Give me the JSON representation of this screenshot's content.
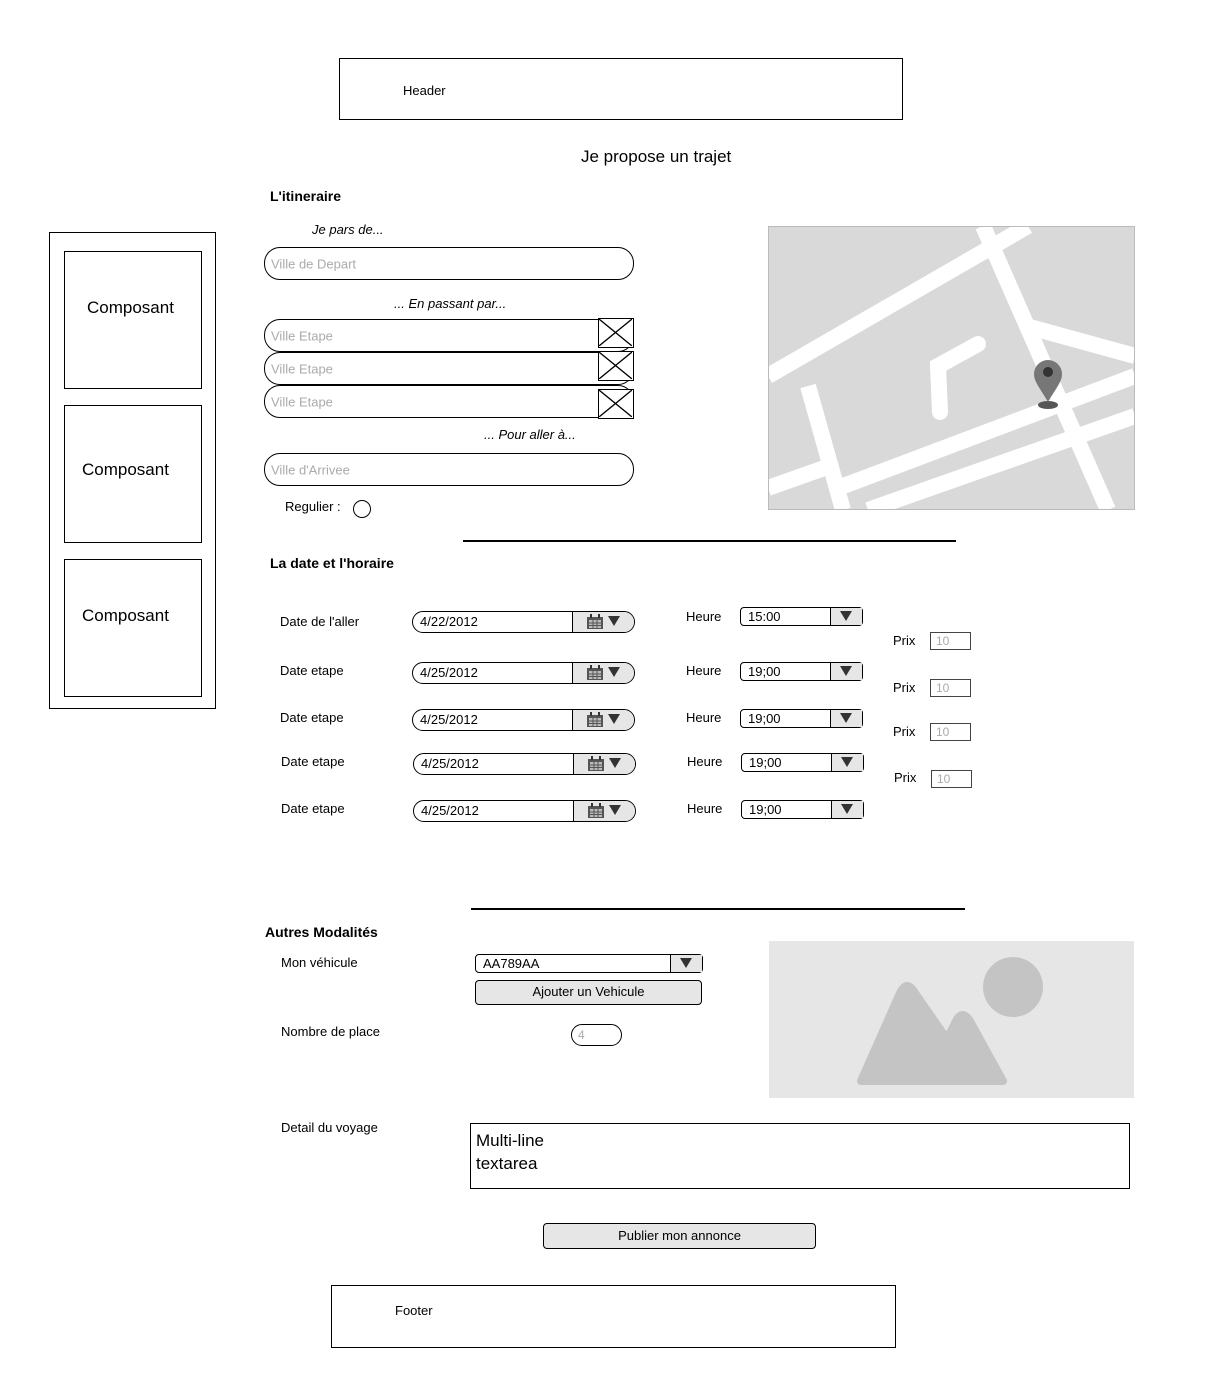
{
  "header": {
    "label": "Header"
  },
  "page_title": "Je propose un trajet",
  "sidebar": {
    "items": [
      {
        "label": "Composant"
      },
      {
        "label": "Composant"
      },
      {
        "label": "Composant"
      }
    ]
  },
  "itinerary": {
    "heading": "L'itineraire",
    "from_label": "Je pars de...",
    "from_placeholder": "Ville de Depart",
    "via_label": "... En passant par...",
    "steps": [
      {
        "placeholder": "Ville Etape"
      },
      {
        "placeholder": "Ville Etape"
      },
      {
        "placeholder": "Ville Etape"
      }
    ],
    "to_label": "... Pour aller à...",
    "to_placeholder": "Ville d'Arrivee",
    "regular_label": "Regulier :"
  },
  "schedule": {
    "heading": "La date et l'horaire",
    "rows": [
      {
        "date_label": "Date de l'aller",
        "date": "4/22/2012",
        "heure_label": "Heure",
        "time": "15:00"
      },
      {
        "date_label": "Date etape",
        "date": "4/25/2012",
        "heure_label": "Heure",
        "time": "19;00"
      },
      {
        "date_label": "Date  etape",
        "date": "4/25/2012",
        "heure_label": "Heure",
        "time": "19;00"
      },
      {
        "date_label": "Date  etape",
        "date": "4/25/2012",
        "heure_label": "Heure",
        "time": "19;00"
      },
      {
        "date_label": "Date  etape",
        "date": "4/25/2012",
        "heure_label": "Heure",
        "time": "19;00"
      }
    ],
    "prices": [
      {
        "label": "Prix",
        "placeholder": "10"
      },
      {
        "label": "Prix",
        "placeholder": "10"
      },
      {
        "label": "Prix",
        "placeholder": "10"
      },
      {
        "label": "Prix",
        "placeholder": "10"
      }
    ]
  },
  "other": {
    "heading": "Autres Modalités",
    "vehicle_label": "Mon véhicule",
    "vehicle_value": "AA789AA",
    "add_vehicle": "Ajouter un Vehicule",
    "seats_label": "Nombre de place",
    "seats_placeholder": "4",
    "detail_label": "Detail du voyage",
    "textarea_line1": "Multi-line",
    "textarea_line2": "textarea"
  },
  "publish_button": "Publier mon annonce",
  "footer": {
    "label": "Footer"
  }
}
